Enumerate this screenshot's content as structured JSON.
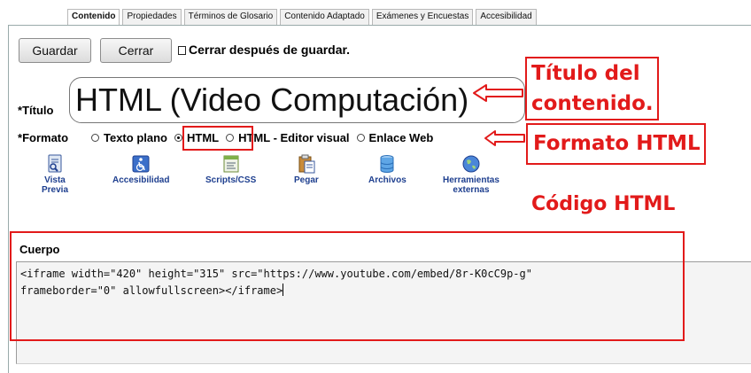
{
  "tabs": [
    {
      "label": "Contenido",
      "active": true
    },
    {
      "label": "Propiedades",
      "active": false
    },
    {
      "label": "Términos de Glosario",
      "active": false
    },
    {
      "label": "Contenido Adaptado",
      "active": false
    },
    {
      "label": "Exámenes y Encuestas",
      "active": false
    },
    {
      "label": "Accesibilidad",
      "active": false
    }
  ],
  "toolbar": {
    "save_label": "Guardar",
    "close_label": "Cerrar",
    "close_after_save_label": "Cerrar después de guardar."
  },
  "title_field": {
    "required_mark": "*",
    "label": "Título",
    "value": "HTML (Video Computación)"
  },
  "format_field": {
    "required_mark": "*",
    "label": "Formato",
    "options": [
      {
        "label": "Texto plano",
        "selected": false
      },
      {
        "label": "HTML",
        "selected": true
      },
      {
        "label": "HTML - Editor visual",
        "selected": false
      },
      {
        "label": "Enlace Web",
        "selected": false
      }
    ]
  },
  "tools": [
    {
      "label_lines": [
        "Vista",
        "Previa"
      ],
      "icon": "preview-icon"
    },
    {
      "label_lines": [
        "Accesibilidad"
      ],
      "icon": "accessibility-icon"
    },
    {
      "label_lines": [
        "Scripts/CSS"
      ],
      "icon": "scripts-icon"
    },
    {
      "label_lines": [
        "Pegar"
      ],
      "icon": "paste-icon"
    },
    {
      "label_lines": [
        "Archivos"
      ],
      "icon": "files-icon"
    },
    {
      "label_lines": [
        "Herramientas",
        "externas"
      ],
      "icon": "globe-icon"
    }
  ],
  "body_field": {
    "label": "Cuerpo",
    "lines": [
      "<iframe width=\"420\" height=\"315\" src=\"https://www.youtube.com/embed/8r-K0cC9p-g\"",
      "frameborder=\"0\" allowfullscreen></iframe>"
    ]
  },
  "annotations": {
    "title_callout_lines": [
      "Título del",
      "contenido."
    ],
    "format_callout": "Formato HTML",
    "code_callout": "Código HTML",
    "color": "#e21a1a"
  }
}
